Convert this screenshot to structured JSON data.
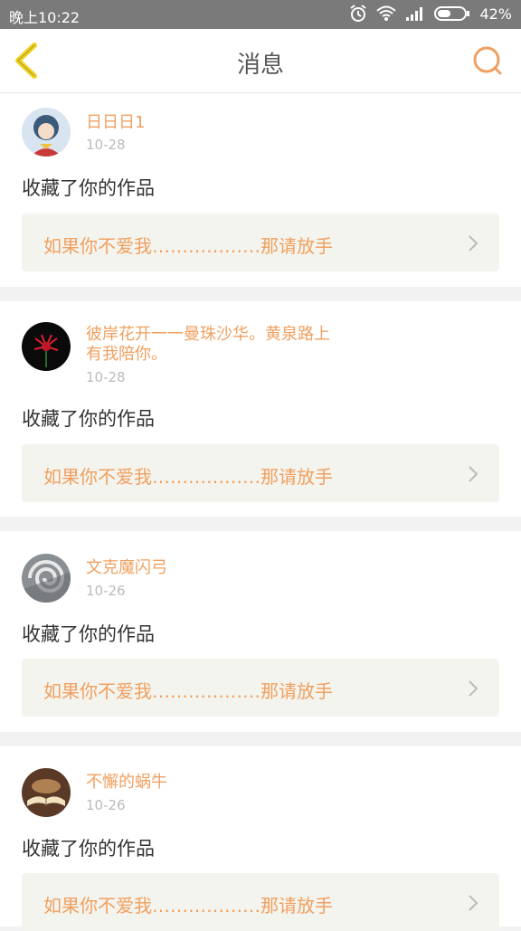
{
  "status_bar": {
    "time": "晚上10:22",
    "battery": "42%",
    "icons": [
      "alarm-icon",
      "wifi-icon",
      "signal-icon",
      "battery-icon"
    ]
  },
  "header": {
    "title": "消息",
    "back_icon": "chevron-left-icon",
    "search_icon": "search-icon"
  },
  "colors": {
    "accent": "#f0a060",
    "back_yellow": "#f0d020",
    "card_bg": "#ffffff",
    "work_bg": "#f4f4ee",
    "page_bg": "#f2f2f2"
  },
  "messages": [
    {
      "name": "日日日1",
      "date": "10-28",
      "action": "收藏了你的作品",
      "work_title": "如果你不爱我………………那请放手"
    },
    {
      "name": "彼岸花开一一曼珠沙华。黄泉路上有我陪你。",
      "date": "10-28",
      "action": "收藏了你的作品",
      "work_title": "如果你不爱我………………那请放手"
    },
    {
      "name": "文克魔闪弓",
      "date": "10-26",
      "action": "收藏了你的作品",
      "work_title": "如果你不爱我………………那请放手"
    },
    {
      "name": "不懈的蜗牛",
      "date": "10-26",
      "action": "收藏了你的作品",
      "work_title": "如果你不爱我………………那请放手"
    }
  ]
}
